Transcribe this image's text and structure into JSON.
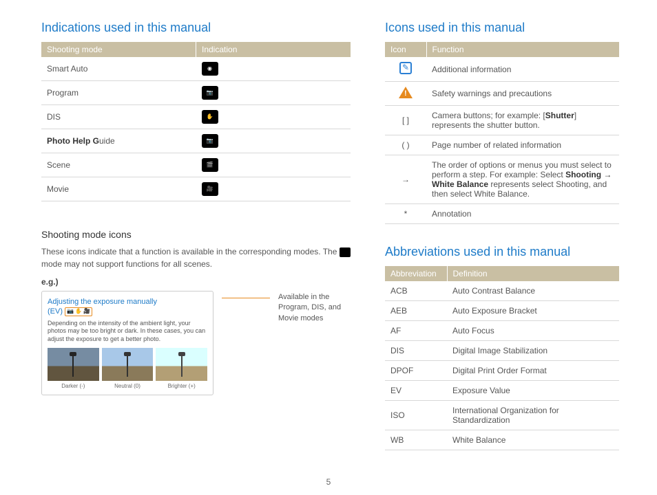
{
  "left": {
    "heading_indications": "Indications used in this manual",
    "table_indications": {
      "header": {
        "col1": "Shooting mode",
        "col2": "Indication"
      },
      "rows": [
        {
          "mode": "Smart Auto",
          "icon_label": "SMART"
        },
        {
          "mode": "Program",
          "icon_label": "P"
        },
        {
          "mode": "DIS",
          "icon_label": "DIS"
        },
        {
          "mode_bold": "Photo Help G",
          "mode_rest": "uide",
          "icon_label": "G"
        },
        {
          "mode": "Scene",
          "icon_label": "SCENE"
        },
        {
          "mode": "Movie",
          "icon_label": "MOVIE"
        }
      ]
    },
    "sub_heading": "Shooting mode icons",
    "paragraph_a": "These icons indicate that a function is available in the corresponding modes. The ",
    "paragraph_b": " mode may not support functions for all scenes.",
    "eg_label": "e.g.)",
    "example": {
      "title_a": "Adjusting the exposure manually",
      "title_b": "(EV)",
      "badges": "📷 ✋ 🎥",
      "desc": "Depending on the intensity of the ambient light, your photos may be too bright or dark. In these cases, you can adjust the exposure to get a better photo.",
      "thumbs": [
        {
          "label": "Darker (-)"
        },
        {
          "label": "Neutral (0)"
        },
        {
          "label": "Brighter (+)"
        }
      ]
    },
    "callout": "Available in the Program, DIS, and Movie modes"
  },
  "right": {
    "heading_icons": "Icons used in this manual",
    "table_icons": {
      "header": {
        "col1": "Icon",
        "col2": "Function"
      },
      "rows": [
        {
          "type": "info",
          "text": "Additional information"
        },
        {
          "type": "warn",
          "text": "Safety warnings and precautions"
        },
        {
          "symbol": "[  ]",
          "text_a": "Camera buttons; for example: [",
          "bold": "Shutter",
          "text_b": "] represents the shutter button."
        },
        {
          "symbol": "(  )",
          "text": "Page number of related information"
        },
        {
          "symbol": "→",
          "text_a": "The order of options or menus you must select to perform a step. For example: Select ",
          "bold": "Shooting → White Balance",
          "text_b": " represents select Shooting, and then select White Balance."
        },
        {
          "symbol": "*",
          "text": "Annotation"
        }
      ]
    },
    "heading_abbrev": "Abbreviations used in this manual",
    "table_abbrev": {
      "header": {
        "col1": "Abbreviation",
        "col2": "Definition"
      },
      "rows": [
        {
          "abbr": "ACB",
          "def": "Auto Contrast Balance"
        },
        {
          "abbr": "AEB",
          "def": "Auto Exposure Bracket"
        },
        {
          "abbr": "AF",
          "def": "Auto Focus"
        },
        {
          "abbr": "DIS",
          "def": "Digital Image Stabilization"
        },
        {
          "abbr": "DPOF",
          "def": "Digital Print Order Format"
        },
        {
          "abbr": "EV",
          "def": "Exposure Value"
        },
        {
          "abbr": "ISO",
          "def": "International Organization for Standardization"
        },
        {
          "abbr": "WB",
          "def": "White Balance"
        }
      ]
    }
  },
  "page_number": "5"
}
